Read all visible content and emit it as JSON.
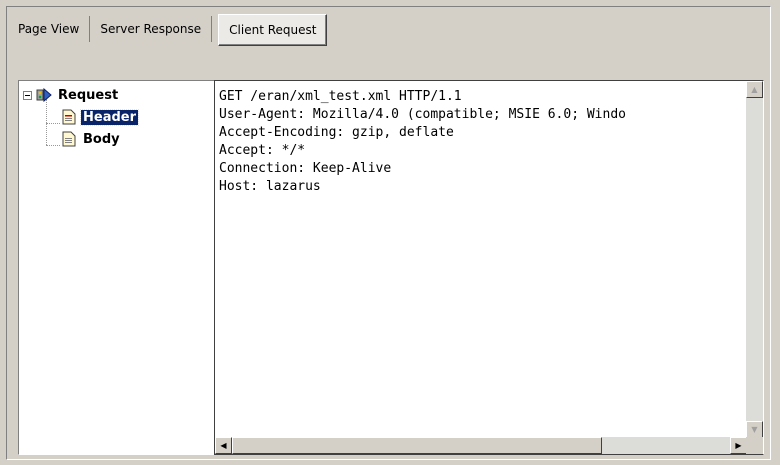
{
  "tabs": [
    {
      "label": "Page View",
      "active": false
    },
    {
      "label": "Server Response",
      "active": false
    },
    {
      "label": "Client Request",
      "active": true
    }
  ],
  "tree": {
    "root": {
      "label": "Request",
      "icon": "request-tree-icon",
      "expanded": true
    },
    "children": [
      {
        "label": "Header",
        "icon": "document-icon",
        "selected": true
      },
      {
        "label": "Body",
        "icon": "document-icon",
        "selected": false
      }
    ]
  },
  "content": {
    "lines": [
      "GET /eran/xml_test.xml HTTP/1.1",
      "User-Agent: Mozilla/4.0 (compatible; MSIE 6.0; Windo",
      "Accept-Encoding: gzip, deflate",
      "Accept: */*",
      "Connection: Keep-Alive",
      "Host: lazarus"
    ]
  },
  "scrollbars": {
    "up_arrow": "▲",
    "down_arrow": "▼",
    "left_arrow": "◀",
    "right_arrow": "▶"
  },
  "colors": {
    "window_bg": "#d4d0c8",
    "selection_bg": "#0a246a",
    "selection_fg": "#ffffff"
  }
}
